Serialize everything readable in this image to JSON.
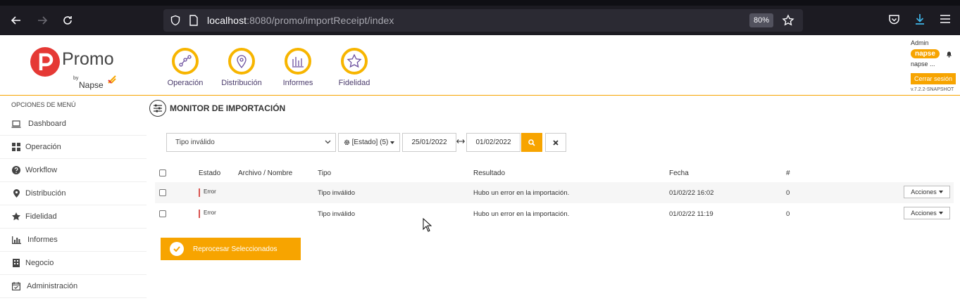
{
  "browser": {
    "url_host": "localhost",
    "url_rest": ":8080/promo/importReceipt/index",
    "zoom": "80%"
  },
  "brand": {
    "name": "Promo",
    "by": "by",
    "company": "Napse",
    "accent": "#f7a400"
  },
  "modules": [
    {
      "label": "Operación",
      "icon": "graph-nodes-icon"
    },
    {
      "label": "Distribución",
      "icon": "map-pin-icon"
    },
    {
      "label": "Informes",
      "icon": "bar-chart-icon"
    },
    {
      "label": "Fidelidad",
      "icon": "star-icon"
    }
  ],
  "user": {
    "name": "Admin",
    "badge": "napse",
    "tenant": "napse ...",
    "logout_label": "Cerrar sesión",
    "version": "v.7.2.2-SNAPSHOT"
  },
  "sidebar": {
    "title": "OPCIONES DE MENÚ",
    "items": [
      {
        "label": "Dashboard",
        "icon": "laptop-icon"
      },
      {
        "label": "Operación",
        "icon": "grid-icon"
      },
      {
        "label": "Workflow",
        "icon": "question-icon"
      },
      {
        "label": "Distribución",
        "icon": "map-pin-icon"
      },
      {
        "label": "Fidelidad",
        "icon": "star-icon"
      },
      {
        "label": "Informes",
        "icon": "bar-chart-icon"
      },
      {
        "label": "Negocio",
        "icon": "building-icon"
      },
      {
        "label": "Administración",
        "icon": "calendar-check-icon"
      }
    ]
  },
  "page": {
    "title": "MONITOR DE IMPORTACIÓN"
  },
  "filters": {
    "tipo_selected": "Tipo inválido",
    "estado_label": "[Estado] (5)",
    "date_from": "25/01/2022",
    "date_to": "01/02/2022"
  },
  "table": {
    "headers": {
      "estado": "Estado",
      "archivo": "Archivo / Nombre",
      "tipo": "Tipo",
      "resultado": "Resultado",
      "fecha": "Fecha",
      "num": "#"
    },
    "rows": [
      {
        "estado": "Error",
        "archivo": "",
        "tipo": "Tipo inválido",
        "resultado": "Hubo un error en la importación.",
        "fecha": "01/02/22 16:02",
        "num": "0",
        "acciones": "Acciones"
      },
      {
        "estado": "Error",
        "archivo": "",
        "tipo": "Tipo inválido",
        "resultado": "Hubo un error en la importación.",
        "fecha": "01/02/22 11:19",
        "num": "0",
        "acciones": "Acciones"
      }
    ]
  },
  "actions": {
    "reprocess_label": "Reprocesar Seleccionados"
  }
}
